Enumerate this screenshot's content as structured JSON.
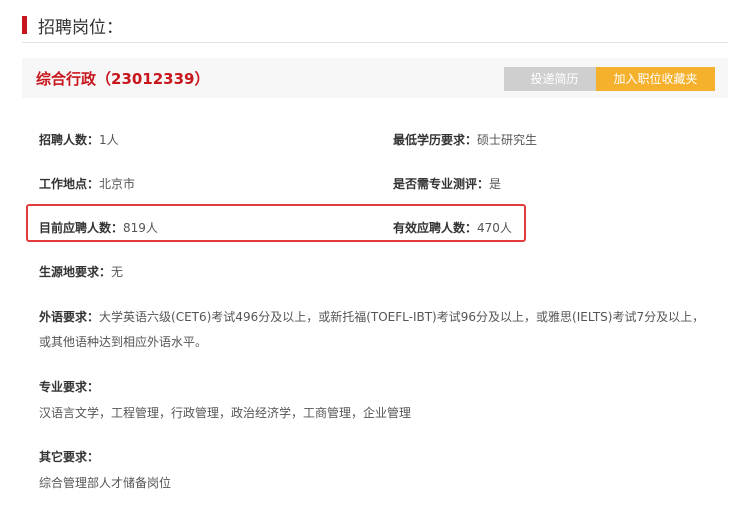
{
  "section": {
    "title": "招聘岗位："
  },
  "job": {
    "title": "综合行政（23012339）"
  },
  "buttons": {
    "submit": "投递简历",
    "favorite": "加入职位收藏夹"
  },
  "fields": {
    "headcount": {
      "label": "招聘人数：",
      "value": "1人"
    },
    "education": {
      "label": "最低学历要求：",
      "value": "硕士研究生"
    },
    "location": {
      "label": "工作地点：",
      "value": "北京市"
    },
    "test": {
      "label": "是否需专业测评：",
      "value": "是"
    },
    "applicants": {
      "label": "目前应聘人数：",
      "value": "819人"
    },
    "valid": {
      "label": "有效应聘人数：",
      "value": "470人"
    },
    "origin": {
      "label": "生源地要求：",
      "value": "无"
    }
  },
  "language": {
    "label": "外语要求：",
    "line1": "大学英语六级(CET6)考试496分及以上，或新托福(TOEFL-IBT)考试96分及以上，或雅思(IELTS)考试7分及以上，",
    "line2": "或其他语种达到相应外语水平。"
  },
  "major": {
    "label": "专业要求：",
    "value": "汉语言文学，工程管理，行政管理，政治经济学，工商管理，企业管理"
  },
  "other": {
    "label": "其它要求：",
    "value": "综合管理部人才储备岗位"
  }
}
